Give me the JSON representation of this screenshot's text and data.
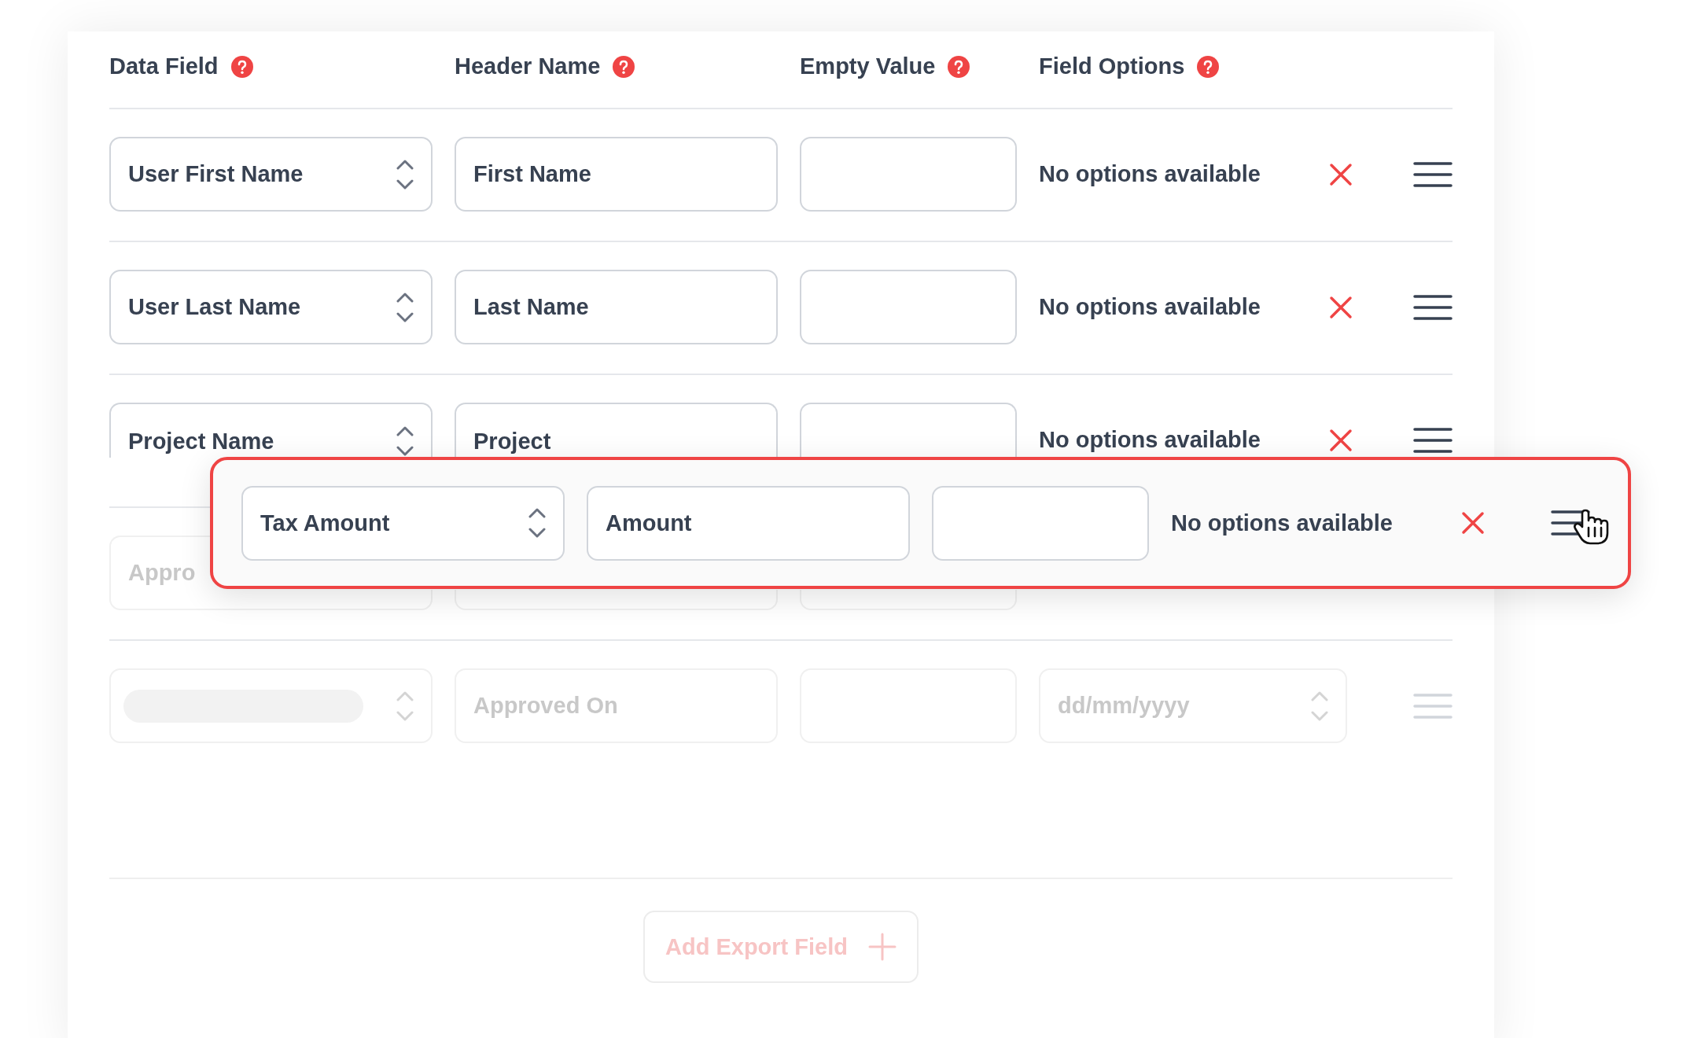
{
  "columns": [
    {
      "label": "Data Field"
    },
    {
      "label": "Header Name"
    },
    {
      "label": "Empty Value"
    },
    {
      "label": "Field Options"
    }
  ],
  "rows": [
    {
      "kind": "normal",
      "data_field": "User First Name",
      "header_name": "First Name",
      "options_text": "No options available"
    },
    {
      "kind": "normal",
      "data_field": "User Last Name",
      "header_name": "Last Name",
      "options_text": "No options available"
    },
    {
      "kind": "normal",
      "data_field": "Project Name",
      "header_name": "Project",
      "options_text": "No options available"
    },
    {
      "kind": "dragging",
      "data_field": "Tax Amount",
      "header_name": "Amount",
      "options_text": "No options available"
    },
    {
      "kind": "drop-target",
      "data_field": "Appro"
    },
    {
      "kind": "ghost",
      "header_name": "Approved On",
      "options_placeholder": "dd/mm/yyyy"
    }
  ],
  "add_button": {
    "label": "Add Export Field",
    "disabled": true
  }
}
